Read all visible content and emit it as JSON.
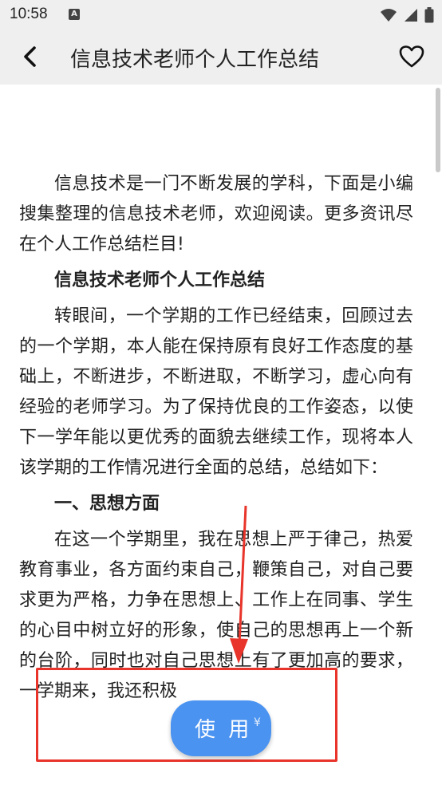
{
  "status_bar": {
    "time": "10:58",
    "notification_icon": "A",
    "icons": [
      "wifi-icon",
      "signal-icon",
      "battery-icon"
    ]
  },
  "app_bar": {
    "title": "信息技术老师个人工作总结",
    "back_icon": "chevron-left-icon",
    "favorite_icon": "heart-outline-icon"
  },
  "article": {
    "paragraphs": [
      {
        "type": "text",
        "text": "信息技术是一门不断发展的学科，下面是小编搜集整理的信息技术老师，欢迎阅读。更多资讯尽在个人工作总结栏目!"
      },
      {
        "type": "heading",
        "text": "信息技术老师个人工作总结"
      },
      {
        "type": "text",
        "text": "转眼间，一个学期的工作已经结束，回顾过去的一个学期，本人能在保持原有良好工作态度的基础上，不断进步，不断进取，不断学习，虚心向有经验的老师学习。为了保持优良的工作姿态，以使下一学年能以更优秀的面貌去继续工作，现将本人该学期的工作情况进行全面的总结，总结如下："
      },
      {
        "type": "heading",
        "text": "一、思想方面"
      },
      {
        "type": "text",
        "text": "在这一个学期里，我在思想上严于律己，热爱教育事业，各方面约束自己，鞭策自己，对自己要求更为严格，力争在思想上、工作上在同事、学生的心目中树立好的形象，使自己的思想再上一个新的台阶，同时也对自己思想上有了更加高的要求，一学期来，我还积极"
      }
    ]
  },
  "use_button": {
    "label": "使 用",
    "currency": "¥"
  },
  "colors": {
    "accent": "#3d8bf0",
    "annotation": "#e8342a",
    "bar_background": "#efefef"
  }
}
